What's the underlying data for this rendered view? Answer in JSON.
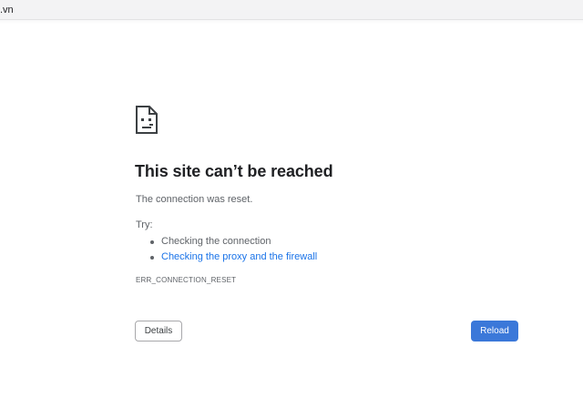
{
  "address_bar": {
    "url_text": ".vn"
  },
  "error_page": {
    "icon": "sad-document-icon",
    "title": "This site can’t be reached",
    "subtitle": "The connection was reset.",
    "try_label": "Try:",
    "suggestions": [
      {
        "text": "Checking the connection",
        "is_link": false
      },
      {
        "text": "Checking the proxy and the firewall",
        "is_link": true
      }
    ],
    "error_code": "ERR_CONNECTION_RESET",
    "details_label": "Details",
    "reload_label": "Reload"
  },
  "colors": {
    "accent": "#3b78d9",
    "link": "#1a73e8",
    "text": "#202124",
    "muted": "#5f6368"
  }
}
